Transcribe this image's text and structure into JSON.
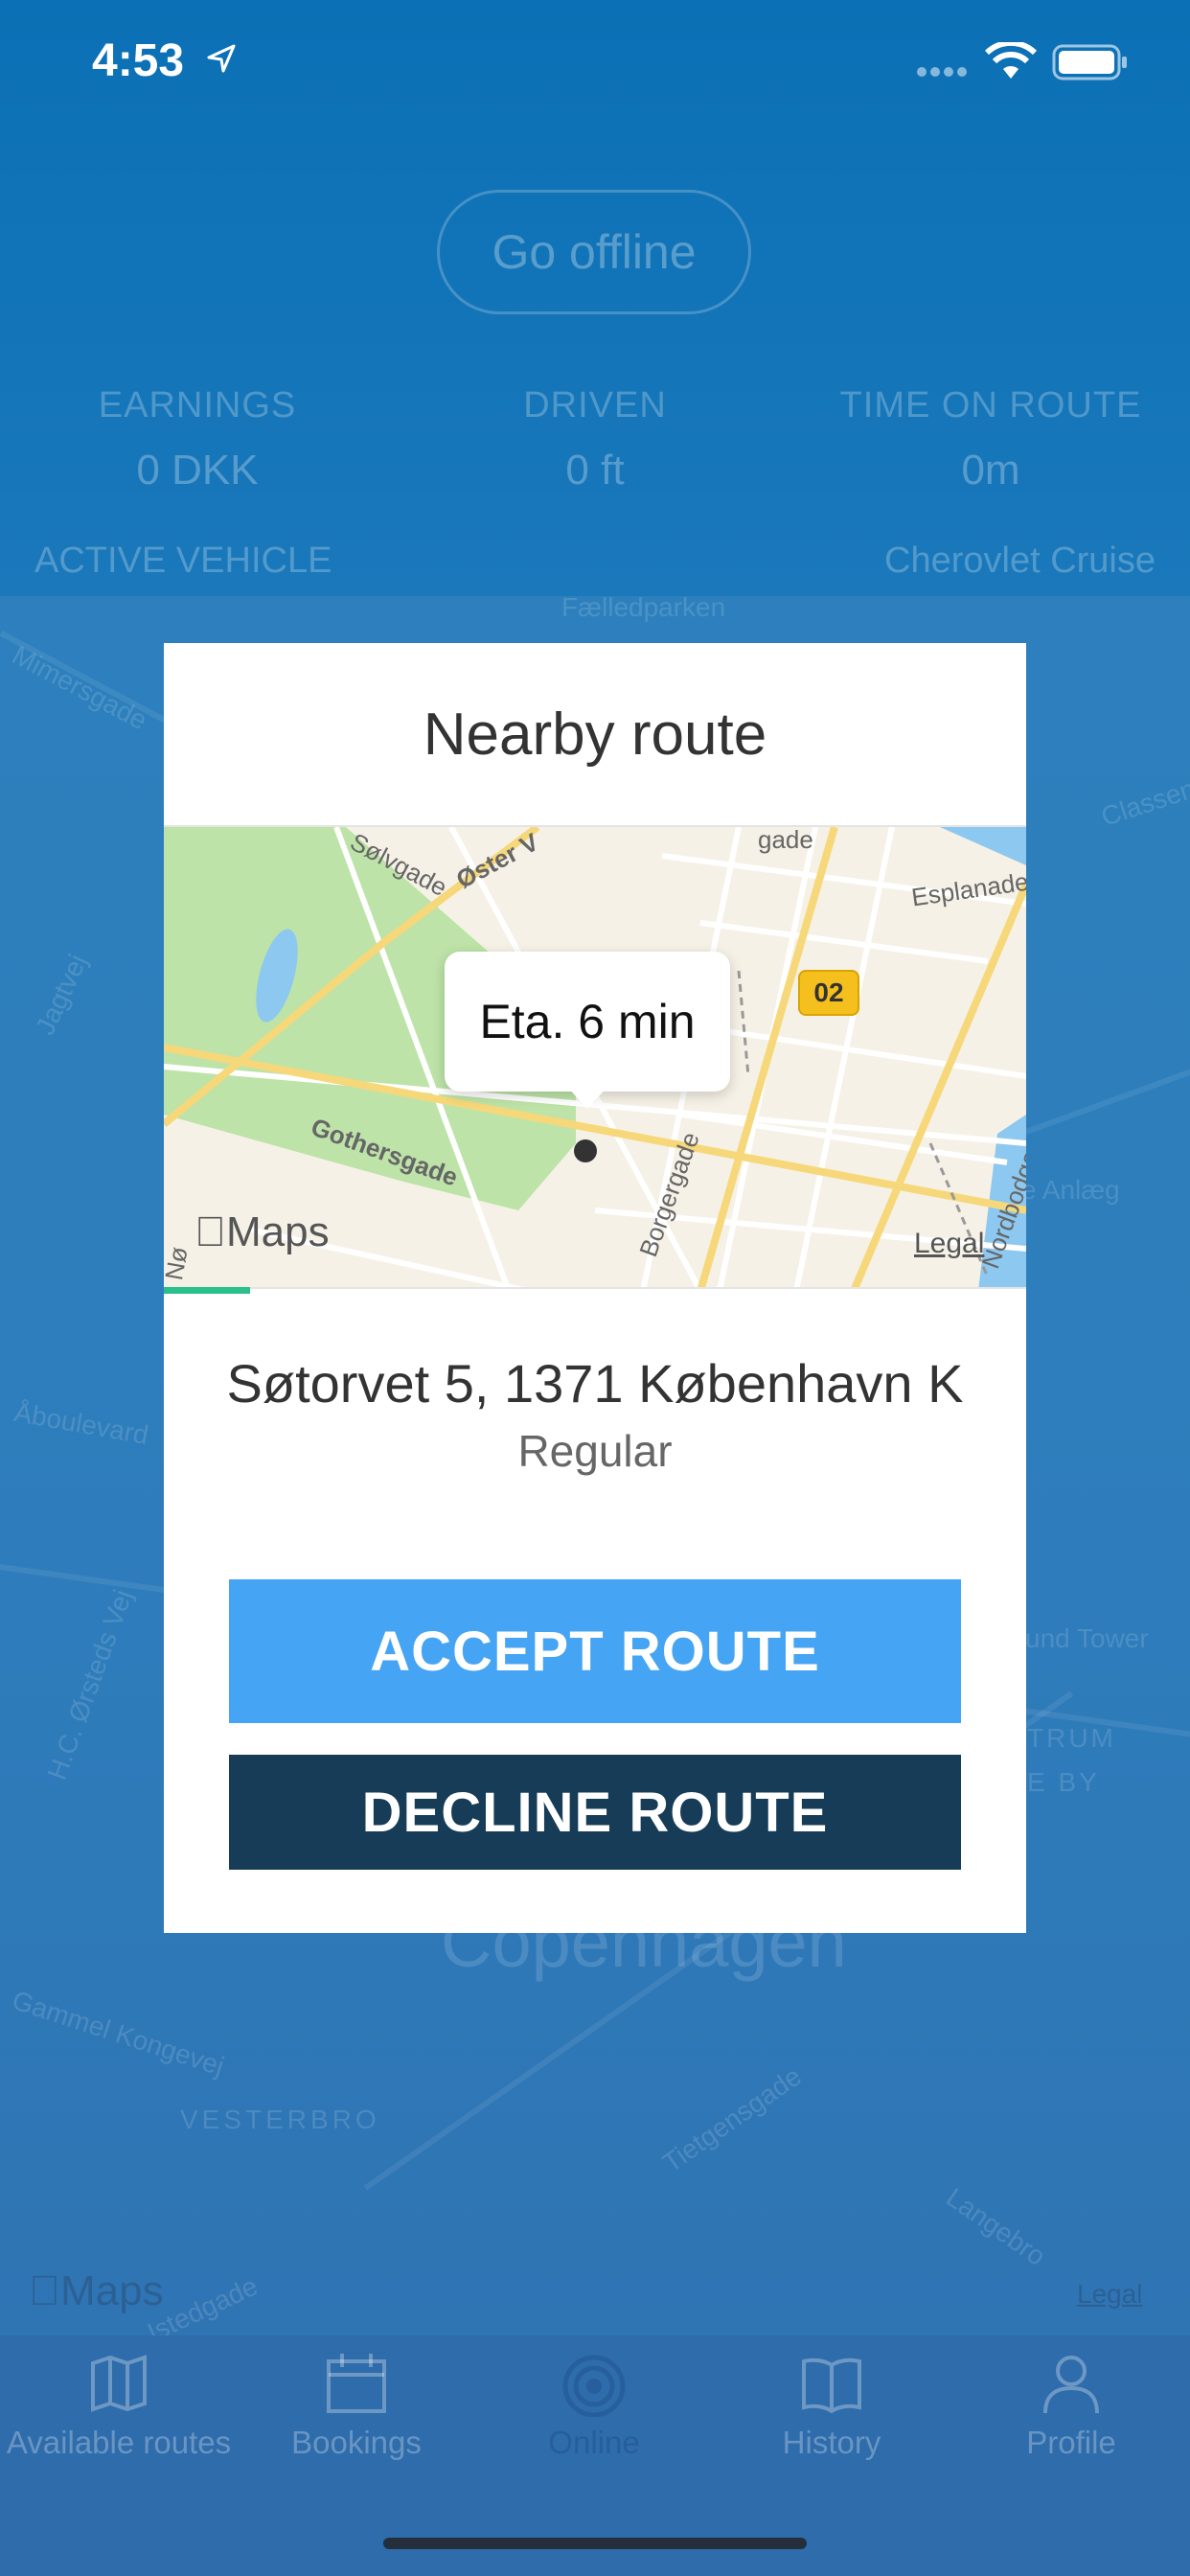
{
  "status_bar": {
    "time": "4:53"
  },
  "background": {
    "go_offline_label": "Go offline",
    "stats": [
      {
        "label": "EARNINGS",
        "value": "0 DKK"
      },
      {
        "label": "DRIVEN",
        "value": "0 ft"
      },
      {
        "label": "TIME ON ROUTE",
        "value": "0m"
      }
    ],
    "active_vehicle_label": "ACTIVE VEHICLE",
    "vehicle_name": "Cherovlet Cruise",
    "map_labels": {
      "mimersgade": "Mimersgade",
      "faelledparken": "Fælledparken",
      "classen": "Classen",
      "jagtvej": "Jagtvej",
      "anlaeg": "e Anlæg",
      "aboulevard": "Åboulevard",
      "orsteds": "H.C. Ørsteds Vej",
      "round_tower": "und Tower",
      "centrum": "TRUM",
      "by": "E BY",
      "copenhagen": "Copenhagen",
      "gammel_kongevej": "Gammel Kongevej",
      "vesterbro": "VESTERBRO",
      "tietgensgade": "Tietgensgade",
      "langebro": "Langebro",
      "istedgade": "Istedgade"
    },
    "maps_logo": "Maps",
    "legal": "Legal"
  },
  "tabbar": {
    "items": [
      {
        "label": "Available routes",
        "icon": "map-icon"
      },
      {
        "label": "Bookings",
        "icon": "calendar-icon"
      },
      {
        "label": "Online",
        "icon": "online-icon"
      },
      {
        "label": "History",
        "icon": "book-icon"
      },
      {
        "label": "Profile",
        "icon": "profile-icon"
      }
    ]
  },
  "modal": {
    "title": "Nearby route",
    "map": {
      "eta": "Eta. 6 min",
      "badge": "02",
      "maps_logo": "Maps",
      "legal": "Legal",
      "labels": {
        "solvgade": "Sølvgade",
        "oster": "Øster V",
        "gade": "gade",
        "esplanade": "Esplanade",
        "gothersgade": "Gothersgade",
        "borgergade": "Borgergade",
        "nordbodgade": "Nordbodgade",
        "no": "Nø"
      }
    },
    "address": "Søtorvet 5, 1371 København K",
    "route_type": "Regular",
    "accept_label": "ACCEPT ROUTE",
    "decline_label": "DECLINE ROUTE"
  },
  "colors": {
    "accept": "#45a4f3",
    "decline": "#163c57",
    "header": "#0b70b5",
    "progress": "#2bbf8e"
  }
}
